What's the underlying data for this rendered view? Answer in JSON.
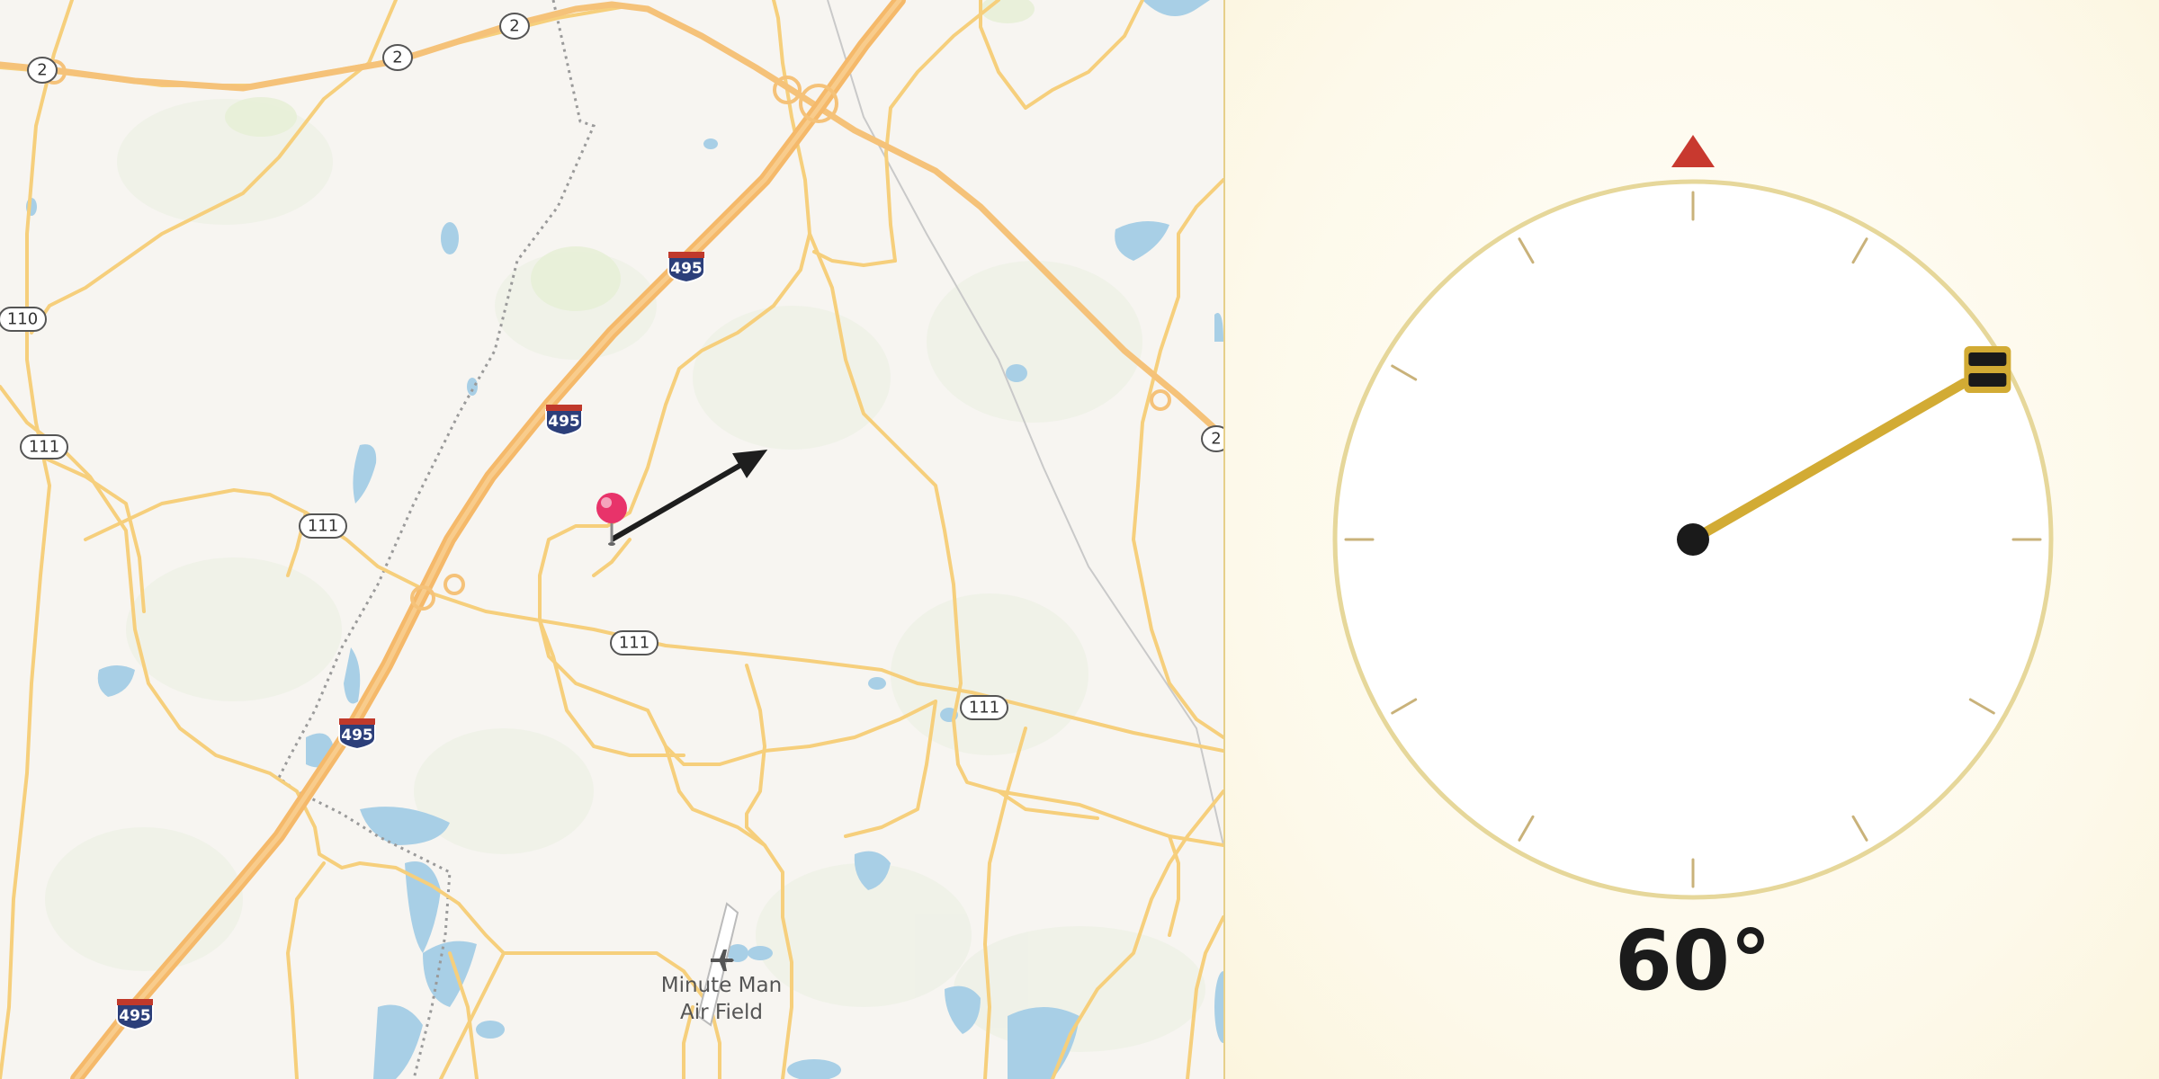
{
  "map": {
    "route_shields": [
      {
        "id": "r2-a",
        "label": "2"
      },
      {
        "id": "r2-b",
        "label": "2"
      },
      {
        "id": "r2-c",
        "label": "2"
      },
      {
        "id": "r2-d",
        "label": "2"
      },
      {
        "id": "r110",
        "label": "110"
      },
      {
        "id": "r111-a",
        "label": "111"
      },
      {
        "id": "r111-b",
        "label": "111"
      },
      {
        "id": "r111-c",
        "label": "111"
      },
      {
        "id": "r111-d",
        "label": "111"
      }
    ],
    "interstate_shields": [
      {
        "id": "i495-a",
        "label": "495"
      },
      {
        "id": "i495-b",
        "label": "495"
      },
      {
        "id": "i495-c",
        "label": "495"
      },
      {
        "id": "i495-d",
        "label": "495"
      }
    ],
    "poi": {
      "label_line1": "Minute Man",
      "label_line2": "Air Field",
      "icon": "airplane-icon"
    },
    "pin": {
      "icon": "map-pin-icon",
      "color": "#e8336a"
    },
    "direction_arrow": {
      "icon": "direction-arrow-icon",
      "heading_deg": 60,
      "color": "#1e1e1e"
    },
    "colors": {
      "land": "#f7f5f1",
      "road": "#f6cf7c",
      "highway": "#f5b96a",
      "water": "#a8cfe6",
      "boundary": "#9a9a9a"
    }
  },
  "compass": {
    "heading_deg": 60,
    "heading_label": "60°",
    "north_marker_color": "#c8392f",
    "ring_color": "#e6d79a",
    "needle_color": "#d2ab34",
    "tick_color": "#c9b27a"
  }
}
